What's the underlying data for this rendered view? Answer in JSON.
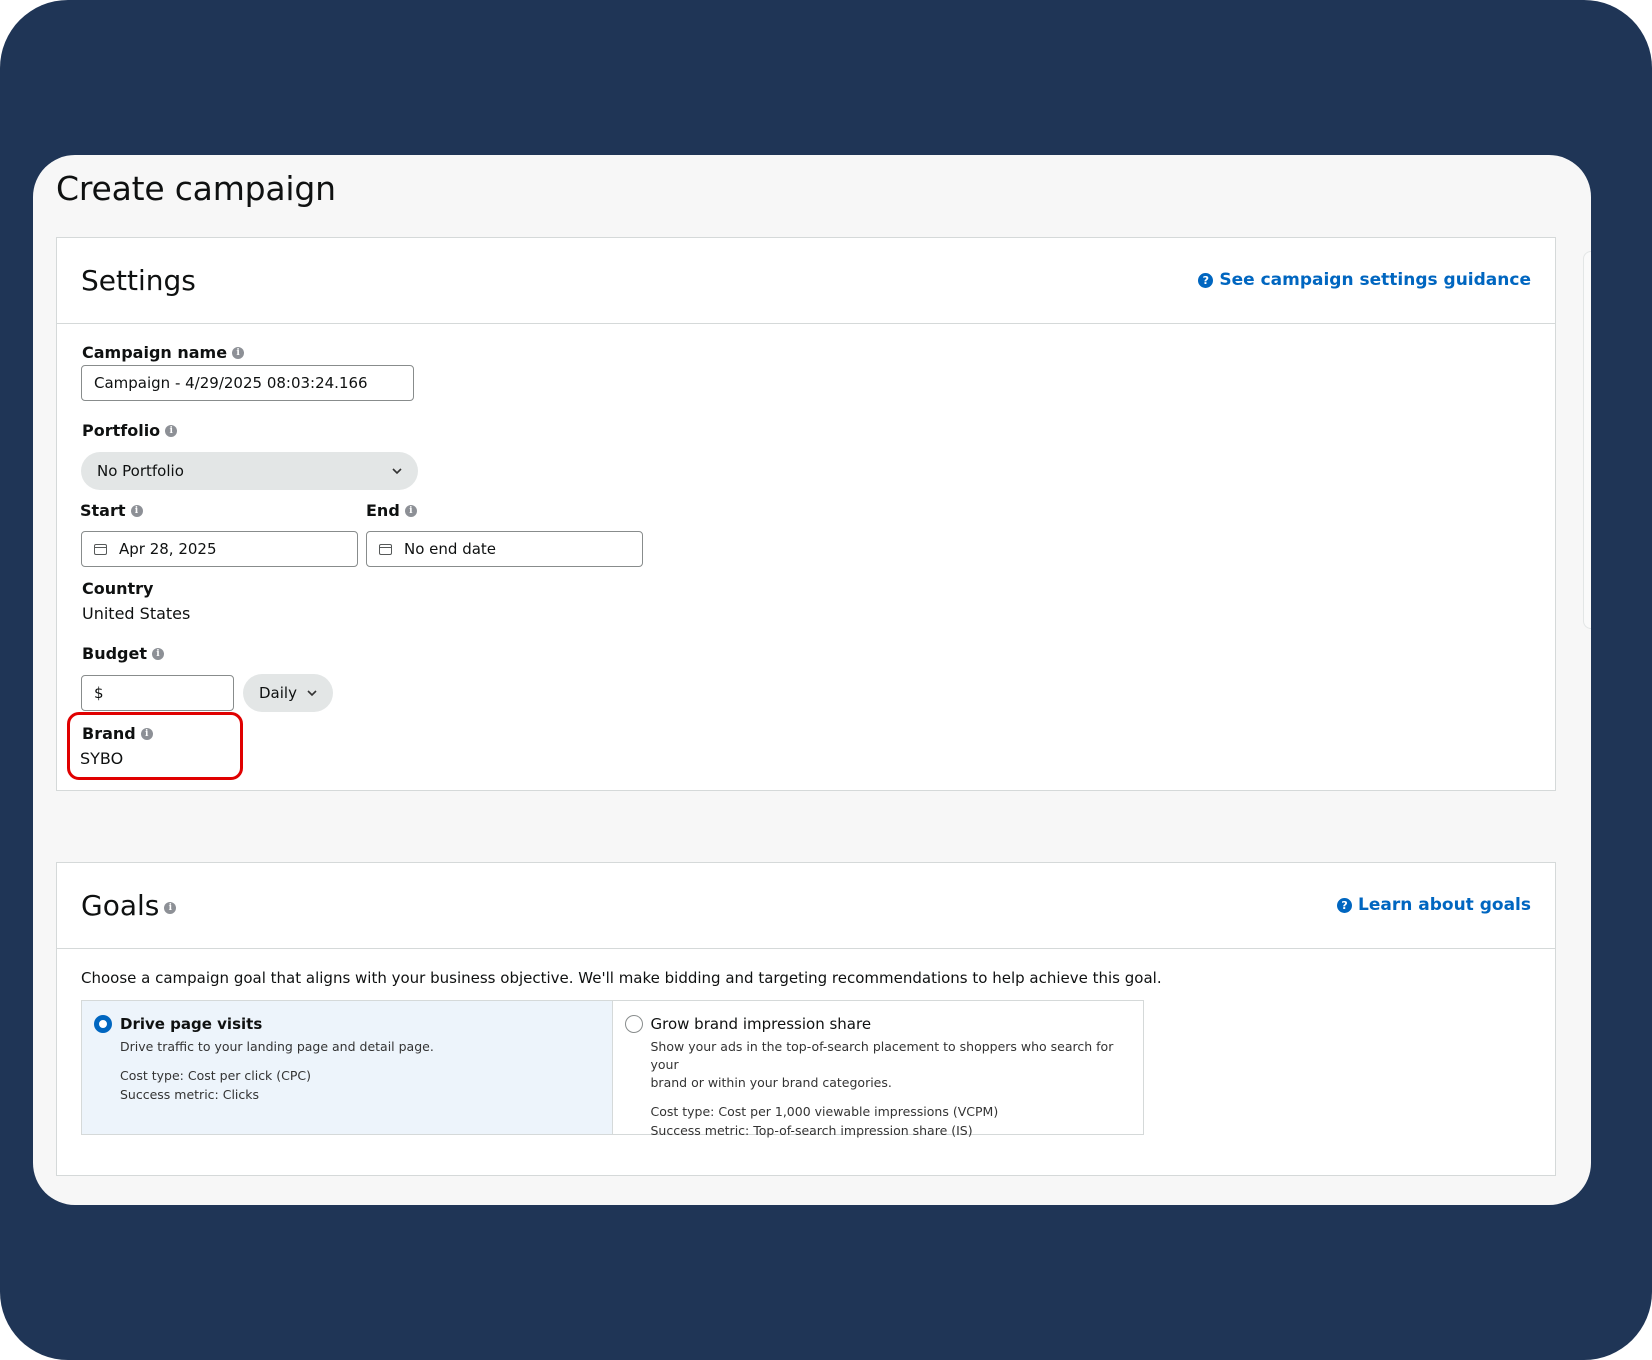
{
  "page_title": "Create campaign",
  "settings": {
    "title": "Settings",
    "guidance_link": "See campaign settings guidance",
    "campaign_name": {
      "label": "Campaign name",
      "value": "Campaign - 4/29/2025 08:03:24.166"
    },
    "portfolio": {
      "label": "Portfolio",
      "value": "No Portfolio"
    },
    "start": {
      "label": "Start",
      "value": "Apr 28, 2025"
    },
    "end": {
      "label": "End",
      "value": "No end date"
    },
    "country": {
      "label": "Country",
      "value": "United States"
    },
    "budget": {
      "label": "Budget",
      "currency": "$",
      "period": "Daily"
    },
    "brand": {
      "label": "Brand",
      "value": "SYBO"
    }
  },
  "goals": {
    "title": "Goals",
    "learn_link": "Learn about goals",
    "description": "Choose a campaign goal that aligns with your business objective. We'll make bidding and targeting recommendations to help achieve this goal.",
    "options": [
      {
        "title": "Drive page visits",
        "subtitle": "Drive traffic to your landing page and detail page.",
        "cost_type": "Cost type: Cost per click (CPC)",
        "metric": "Success metric: Clicks",
        "selected": true
      },
      {
        "title": "Grow brand impression share",
        "subtitle_line1": "Show your ads in the top-of-search placement to shoppers who search for your",
        "subtitle_line2": "brand or within your brand categories.",
        "cost_type": "Cost type: Cost per 1,000 viewable impressions (VCPM)",
        "metric": "Success metric: Top-of-search impression share (IS)",
        "selected": false
      }
    ]
  },
  "colors": {
    "frame_bg": "#1f3556",
    "link": "#0066c0",
    "highlight": "#e00000",
    "selected_option_bg": "#edf4fb"
  }
}
